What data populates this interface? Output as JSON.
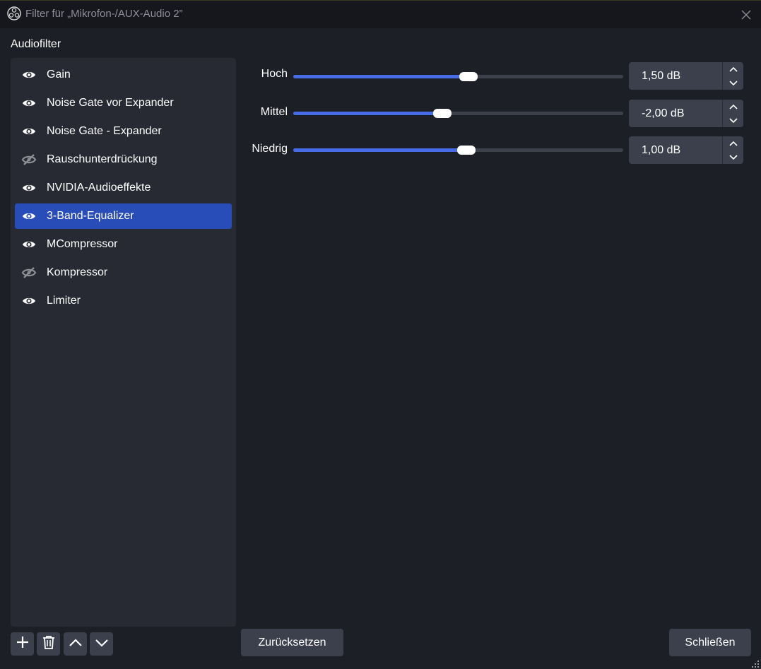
{
  "window": {
    "title": "Filter für „Mikrofon-/AUX-Audio 2”"
  },
  "sidebar": {
    "label": "Audiofilter",
    "filters": [
      {
        "label": "Gain",
        "visible": true,
        "selected": false
      },
      {
        "label": "Noise Gate vor Expander",
        "visible": true,
        "selected": false
      },
      {
        "label": "Noise Gate - Expander",
        "visible": true,
        "selected": false
      },
      {
        "label": "Rauschunterdrückung",
        "visible": false,
        "selected": false
      },
      {
        "label": "NVIDIA-Audioeffekte",
        "visible": true,
        "selected": false
      },
      {
        "label": "3-Band-Equalizer",
        "visible": true,
        "selected": true
      },
      {
        "label": "MCompressor",
        "visible": true,
        "selected": false
      },
      {
        "label": "Kompressor",
        "visible": false,
        "selected": false
      },
      {
        "label": "Limiter",
        "visible": true,
        "selected": false
      }
    ],
    "toolbar": [
      "plus-icon",
      "trash-icon",
      "chevron-up-icon",
      "chevron-down-icon"
    ]
  },
  "properties": [
    {
      "label": "Hoch",
      "value": "1,50 dB",
      "slider_fraction": 0.53
    },
    {
      "label": "Mittel",
      "value": "-2,00 dB",
      "slider_fraction": 0.452
    },
    {
      "label": "Niedrig",
      "value": "1,00 dB",
      "slider_fraction": 0.524
    }
  ],
  "buttons": {
    "reset": "Zurücksetzen",
    "close": "Schließen"
  },
  "colors": {
    "accent": "#476be5",
    "selected": "#284cb8",
    "background": "#1d1f26",
    "panel": "#272a33"
  }
}
